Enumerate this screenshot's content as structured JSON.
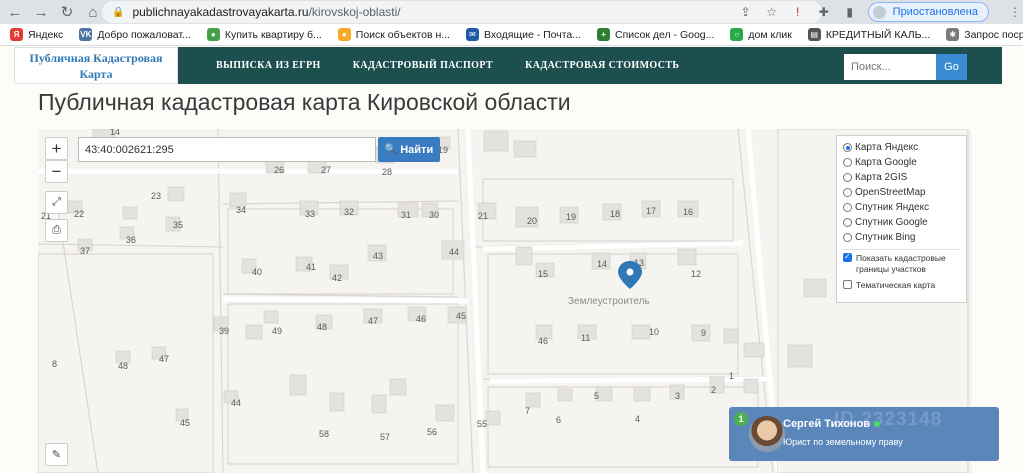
{
  "browser": {
    "url_host": "publichnayakadastrovayakarta.ru",
    "url_path": "/kirovskoj-oblasti/",
    "profile_label": "Приостановлена"
  },
  "bookmarks": [
    {
      "label": "Яндекс",
      "color": "#e53935",
      "glyph": "Я"
    },
    {
      "label": "Добро пожаловат...",
      "color": "#4c75a3",
      "glyph": "VK"
    },
    {
      "label": "Купить квартиру б...",
      "color": "#43a047",
      "glyph": "●"
    },
    {
      "label": "Поиск объектов н...",
      "color": "#f9a825",
      "glyph": "●"
    },
    {
      "label": "Входящие - Почта...",
      "color": "#1e5aa8",
      "glyph": "✉"
    },
    {
      "label": "Список дел - Goog...",
      "color": "#2e7d32",
      "glyph": "+"
    },
    {
      "label": "дом клик",
      "color": "#2aa84a",
      "glyph": "○"
    },
    {
      "label": "КРЕДИТНЫЙ КАЛЬ...",
      "color": "#555555",
      "glyph": "▤"
    },
    {
      "label": "Запрос посредств...",
      "color": "#7a7a7a",
      "glyph": "✱"
    }
  ],
  "header": {
    "logo_line1": "Публичная Кадастровая",
    "logo_line2": "Карта",
    "nav": [
      "ВЫПИСКА ИЗ ЕГРН",
      "КАДАСТРОВЫЙ ПАСПОРТ",
      "КАДАСТРОВАЯ СТОИМОСТЬ"
    ],
    "search_placeholder": "Поиск...",
    "search_button": "Go"
  },
  "page_title": "Публичная кадастровая карта Кировской области",
  "map": {
    "cadastral_number": "43:40:002621:295",
    "find_button": "Найти",
    "zoom_in": "+",
    "zoom_out": "−",
    "place_label": "Землеустроитель",
    "house_numbers": [
      "14",
      "26",
      "27",
      "28",
      "19",
      "23",
      "22",
      "21",
      "34",
      "33",
      "32",
      "31",
      "30",
      "21",
      "20",
      "19",
      "18",
      "17",
      "16",
      "37",
      "36",
      "35",
      "40",
      "41",
      "42",
      "43",
      "44",
      "15",
      "14",
      "13",
      "12",
      "39",
      "49",
      "48",
      "47",
      "46",
      "45",
      "46",
      "11",
      "10",
      "9",
      "8",
      "48",
      "47",
      "44",
      "45",
      "58",
      "57",
      "56",
      "55",
      "7",
      "6",
      "5",
      "4",
      "3",
      "2",
      "1"
    ]
  },
  "layers": {
    "options": [
      "Карта Яндекс",
      "Карта Google",
      "Карта 2GIS",
      "OpenStreetMap",
      "Спутник Яндекс",
      "Спутник Google",
      "Спутник Bing"
    ],
    "selected_index": 0,
    "checkbox_borders": "Показать кадастровые границы участков",
    "checkbox_borders_checked": true,
    "checkbox_thematic": "Тематическая карта",
    "checkbox_thematic_checked": false
  },
  "chat": {
    "badge_count": "1",
    "name": "Сергей Тихонов",
    "role": "Юрист по земельному праву",
    "bg_number": "ID 2323148"
  }
}
